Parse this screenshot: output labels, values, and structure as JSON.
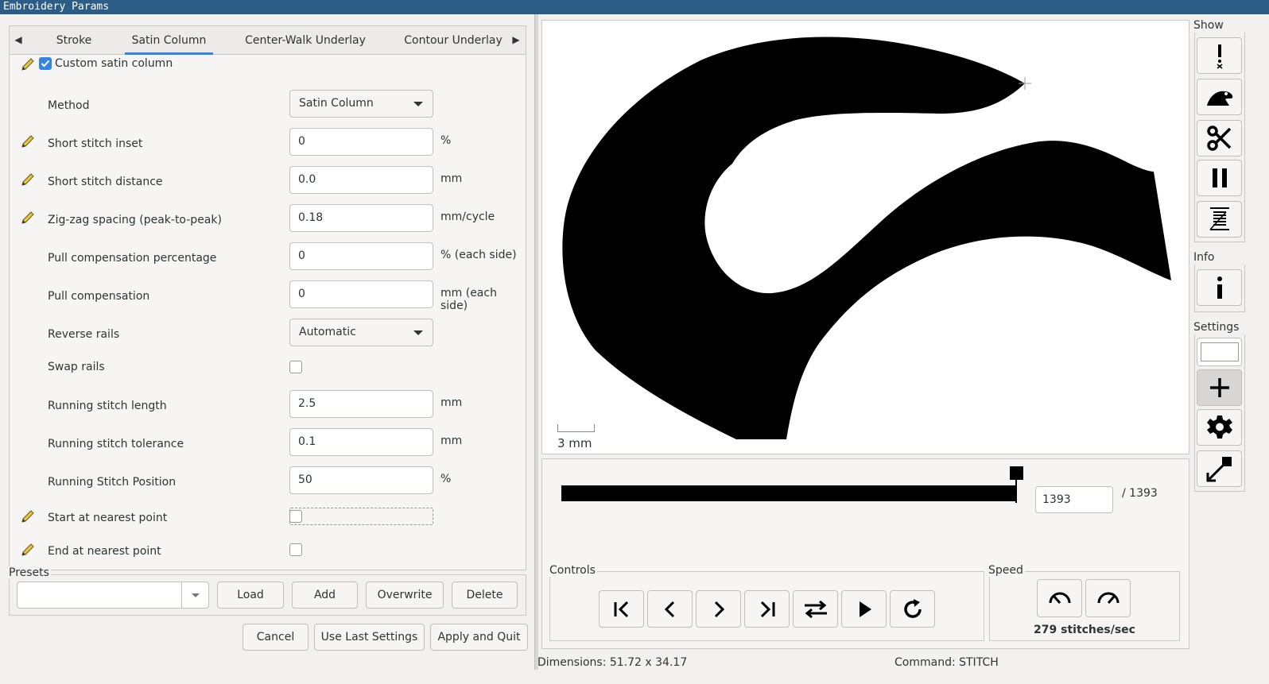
{
  "window": {
    "title": "Embroidery Params"
  },
  "tabs": [
    "Stroke",
    "Satin Column",
    "Center-Walk Underlay",
    "Contour Underlay"
  ],
  "custom_checkbox": {
    "label": "Custom satin column",
    "checked": true
  },
  "params": [
    {
      "label": "Method",
      "kind": "combo",
      "value": "Satin Column",
      "unit": "",
      "pencil": false
    },
    {
      "label": "Short stitch inset",
      "kind": "text",
      "value": "0",
      "unit": "%",
      "pencil": true
    },
    {
      "label": "Short stitch distance",
      "kind": "text",
      "value": "0.0",
      "unit": "mm",
      "pencil": true
    },
    {
      "label": "Zig-zag spacing (peak-to-peak)",
      "kind": "text",
      "value": "0.18",
      "unit": "mm/cycle",
      "pencil": true
    },
    {
      "label": "Pull compensation percentage",
      "kind": "text",
      "value": "0",
      "unit": "% (each side)",
      "pencil": false
    },
    {
      "label": "Pull compensation",
      "kind": "text",
      "value": "0",
      "unit": "mm (each side)",
      "pencil": false
    },
    {
      "label": "Reverse rails",
      "kind": "combo",
      "value": "Automatic",
      "unit": "",
      "pencil": false
    },
    {
      "label": "Swap rails",
      "kind": "check",
      "value": "",
      "unit": "",
      "pencil": false
    },
    {
      "label": "Running stitch length",
      "kind": "text",
      "value": "2.5",
      "unit": "mm",
      "pencil": false
    },
    {
      "label": "Running stitch tolerance",
      "kind": "text",
      "value": "0.1",
      "unit": "mm",
      "pencil": false
    },
    {
      "label": "Running Stitch Position",
      "kind": "text",
      "value": "50",
      "unit": "%",
      "pencil": false
    },
    {
      "label": "Start at nearest point",
      "kind": "check",
      "value": "",
      "unit": "",
      "pencil": true
    },
    {
      "label": "End at nearest point",
      "kind": "check",
      "value": "",
      "unit": "",
      "pencil": true
    }
  ],
  "presets": {
    "title": "Presets",
    "value": "",
    "buttons": [
      "Load",
      "Add",
      "Overwrite",
      "Delete"
    ]
  },
  "footer_buttons": [
    "Cancel",
    "Use Last Settings",
    "Apply and Quit"
  ],
  "preview": {
    "scale_label": "3 mm",
    "stitch_current": "1393",
    "stitch_total": "/ 1393",
    "progress_fraction": 1.0,
    "controls_title": "Controls",
    "speed_title": "Speed",
    "speed_text": "279 stitches/sec"
  },
  "toolbar": {
    "show_title": "Show",
    "info_title": "Info",
    "settings_title": "Settings"
  },
  "status": {
    "dimensions": "Dimensions: 51.72 x 34.17",
    "command": "Command: STITCH"
  },
  "colors": {
    "accent": "#3584e4",
    "titlebar": "#2c5d86",
    "design": "#000000"
  }
}
